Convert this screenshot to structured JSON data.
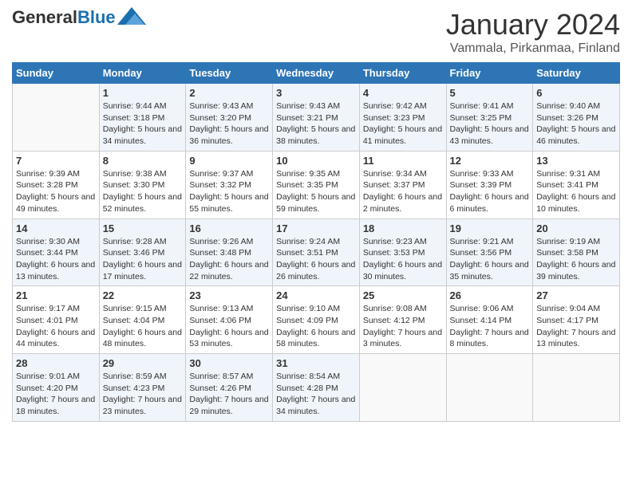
{
  "header": {
    "logo_general": "General",
    "logo_blue": "Blue",
    "month": "January 2024",
    "location": "Vammala, Pirkanmaa, Finland"
  },
  "weekdays": [
    "Sunday",
    "Monday",
    "Tuesday",
    "Wednesday",
    "Thursday",
    "Friday",
    "Saturday"
  ],
  "weeks": [
    [
      {
        "day": "",
        "sunrise": "",
        "sunset": "",
        "daylight": ""
      },
      {
        "day": "1",
        "sunrise": "Sunrise: 9:44 AM",
        "sunset": "Sunset: 3:18 PM",
        "daylight": "Daylight: 5 hours and 34 minutes."
      },
      {
        "day": "2",
        "sunrise": "Sunrise: 9:43 AM",
        "sunset": "Sunset: 3:20 PM",
        "daylight": "Daylight: 5 hours and 36 minutes."
      },
      {
        "day": "3",
        "sunrise": "Sunrise: 9:43 AM",
        "sunset": "Sunset: 3:21 PM",
        "daylight": "Daylight: 5 hours and 38 minutes."
      },
      {
        "day": "4",
        "sunrise": "Sunrise: 9:42 AM",
        "sunset": "Sunset: 3:23 PM",
        "daylight": "Daylight: 5 hours and 41 minutes."
      },
      {
        "day": "5",
        "sunrise": "Sunrise: 9:41 AM",
        "sunset": "Sunset: 3:25 PM",
        "daylight": "Daylight: 5 hours and 43 minutes."
      },
      {
        "day": "6",
        "sunrise": "Sunrise: 9:40 AM",
        "sunset": "Sunset: 3:26 PM",
        "daylight": "Daylight: 5 hours and 46 minutes."
      }
    ],
    [
      {
        "day": "7",
        "sunrise": "Sunrise: 9:39 AM",
        "sunset": "Sunset: 3:28 PM",
        "daylight": "Daylight: 5 hours and 49 minutes."
      },
      {
        "day": "8",
        "sunrise": "Sunrise: 9:38 AM",
        "sunset": "Sunset: 3:30 PM",
        "daylight": "Daylight: 5 hours and 52 minutes."
      },
      {
        "day": "9",
        "sunrise": "Sunrise: 9:37 AM",
        "sunset": "Sunset: 3:32 PM",
        "daylight": "Daylight: 5 hours and 55 minutes."
      },
      {
        "day": "10",
        "sunrise": "Sunrise: 9:35 AM",
        "sunset": "Sunset: 3:35 PM",
        "daylight": "Daylight: 5 hours and 59 minutes."
      },
      {
        "day": "11",
        "sunrise": "Sunrise: 9:34 AM",
        "sunset": "Sunset: 3:37 PM",
        "daylight": "Daylight: 6 hours and 2 minutes."
      },
      {
        "day": "12",
        "sunrise": "Sunrise: 9:33 AM",
        "sunset": "Sunset: 3:39 PM",
        "daylight": "Daylight: 6 hours and 6 minutes."
      },
      {
        "day": "13",
        "sunrise": "Sunrise: 9:31 AM",
        "sunset": "Sunset: 3:41 PM",
        "daylight": "Daylight: 6 hours and 10 minutes."
      }
    ],
    [
      {
        "day": "14",
        "sunrise": "Sunrise: 9:30 AM",
        "sunset": "Sunset: 3:44 PM",
        "daylight": "Daylight: 6 hours and 13 minutes."
      },
      {
        "day": "15",
        "sunrise": "Sunrise: 9:28 AM",
        "sunset": "Sunset: 3:46 PM",
        "daylight": "Daylight: 6 hours and 17 minutes."
      },
      {
        "day": "16",
        "sunrise": "Sunrise: 9:26 AM",
        "sunset": "Sunset: 3:48 PM",
        "daylight": "Daylight: 6 hours and 22 minutes."
      },
      {
        "day": "17",
        "sunrise": "Sunrise: 9:24 AM",
        "sunset": "Sunset: 3:51 PM",
        "daylight": "Daylight: 6 hours and 26 minutes."
      },
      {
        "day": "18",
        "sunrise": "Sunrise: 9:23 AM",
        "sunset": "Sunset: 3:53 PM",
        "daylight": "Daylight: 6 hours and 30 minutes."
      },
      {
        "day": "19",
        "sunrise": "Sunrise: 9:21 AM",
        "sunset": "Sunset: 3:56 PM",
        "daylight": "Daylight: 6 hours and 35 minutes."
      },
      {
        "day": "20",
        "sunrise": "Sunrise: 9:19 AM",
        "sunset": "Sunset: 3:58 PM",
        "daylight": "Daylight: 6 hours and 39 minutes."
      }
    ],
    [
      {
        "day": "21",
        "sunrise": "Sunrise: 9:17 AM",
        "sunset": "Sunset: 4:01 PM",
        "daylight": "Daylight: 6 hours and 44 minutes."
      },
      {
        "day": "22",
        "sunrise": "Sunrise: 9:15 AM",
        "sunset": "Sunset: 4:04 PM",
        "daylight": "Daylight: 6 hours and 48 minutes."
      },
      {
        "day": "23",
        "sunrise": "Sunrise: 9:13 AM",
        "sunset": "Sunset: 4:06 PM",
        "daylight": "Daylight: 6 hours and 53 minutes."
      },
      {
        "day": "24",
        "sunrise": "Sunrise: 9:10 AM",
        "sunset": "Sunset: 4:09 PM",
        "daylight": "Daylight: 6 hours and 58 minutes."
      },
      {
        "day": "25",
        "sunrise": "Sunrise: 9:08 AM",
        "sunset": "Sunset: 4:12 PM",
        "daylight": "Daylight: 7 hours and 3 minutes."
      },
      {
        "day": "26",
        "sunrise": "Sunrise: 9:06 AM",
        "sunset": "Sunset: 4:14 PM",
        "daylight": "Daylight: 7 hours and 8 minutes."
      },
      {
        "day": "27",
        "sunrise": "Sunrise: 9:04 AM",
        "sunset": "Sunset: 4:17 PM",
        "daylight": "Daylight: 7 hours and 13 minutes."
      }
    ],
    [
      {
        "day": "28",
        "sunrise": "Sunrise: 9:01 AM",
        "sunset": "Sunset: 4:20 PM",
        "daylight": "Daylight: 7 hours and 18 minutes."
      },
      {
        "day": "29",
        "sunrise": "Sunrise: 8:59 AM",
        "sunset": "Sunset: 4:23 PM",
        "daylight": "Daylight: 7 hours and 23 minutes."
      },
      {
        "day": "30",
        "sunrise": "Sunrise: 8:57 AM",
        "sunset": "Sunset: 4:26 PM",
        "daylight": "Daylight: 7 hours and 29 minutes."
      },
      {
        "day": "31",
        "sunrise": "Sunrise: 8:54 AM",
        "sunset": "Sunset: 4:28 PM",
        "daylight": "Daylight: 7 hours and 34 minutes."
      },
      {
        "day": "",
        "sunrise": "",
        "sunset": "",
        "daylight": ""
      },
      {
        "day": "",
        "sunrise": "",
        "sunset": "",
        "daylight": ""
      },
      {
        "day": "",
        "sunrise": "",
        "sunset": "",
        "daylight": ""
      }
    ]
  ]
}
